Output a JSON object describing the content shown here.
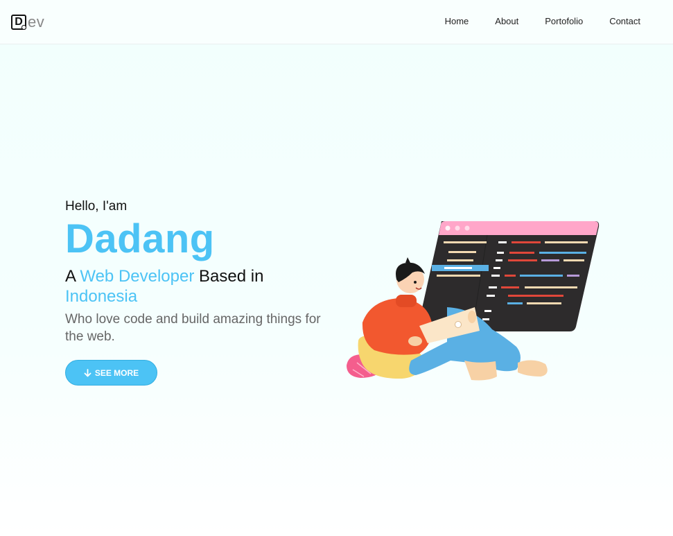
{
  "logo": {
    "mark": "D",
    "text": "ev"
  },
  "nav": {
    "items": [
      "Home",
      "About",
      "Portofolio",
      "Contact"
    ]
  },
  "hero": {
    "greeting": "Hello, I'am",
    "name": "Dadang",
    "tagline_prefix": "A ",
    "tagline_role": "Web Developer",
    "tagline_mid": " Based in",
    "tagline_location": "Indonesia",
    "description": "Who love code and build amazing things for the web.",
    "cta_label": "SEE MORE",
    "cta_icon": "arrow-down-icon"
  },
  "colors": {
    "accent": "#4cc3f5",
    "text": "#111111",
    "muted": "#666666",
    "editor_bg": "#2d2b2c",
    "editor_bar": "#ffa6c9"
  },
  "illustration": "developer-with-laptop-illustration"
}
